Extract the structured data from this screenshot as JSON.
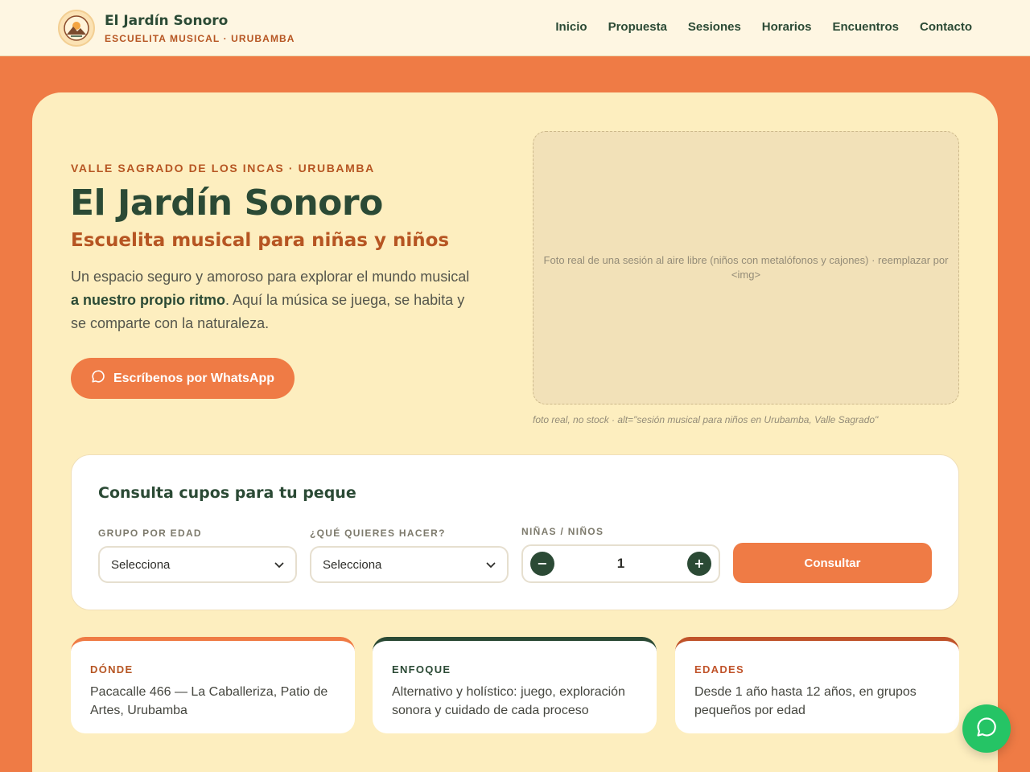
{
  "brand": {
    "name": "El Jardín Sonoro",
    "subtitle": "ESCUELITA MUSICAL · URUBAMBA",
    "logo_icon": "sun-mountain-logo-icon"
  },
  "nav": {
    "items": [
      "Inicio",
      "Propuesta",
      "Sesiones",
      "Horarios",
      "Encuentros",
      "Contacto"
    ]
  },
  "hero": {
    "eyebrow": "VALLE SAGRADO DE LOS INCAS · URUBAMBA",
    "title": "El Jardín Sonoro",
    "subtitle": "Escuelita musical para niñas y niños",
    "desc_part1": "Un espacio seguro y amoroso para explorar el mundo musical ",
    "desc_bold": "a nuestro propio ritmo",
    "desc_part2": ". Aquí la música se juega, se habita y se comparte con la naturaleza.",
    "whatsapp_label": "Escríbenos por WhatsApp",
    "whatsapp_icon": "chat-bubble-icon"
  },
  "photo": {
    "placeholder": "Foto real de una sesión al aire libre (niños con metalófonos y cajones) · reemplazar por <img>",
    "caption": "foto real, no stock · alt=\"sesión musical para niños en Urubamba, Valle Sagrado\""
  },
  "booking": {
    "title": "Consulta cupos para tu peque",
    "age_label": "GRUPO POR EDAD",
    "age_value": "Selecciona",
    "activity_label": "¿QUÉ QUIERES HACER?",
    "activity_value": "Selecciona",
    "kids_label": "NIÑAS / NIÑOS",
    "kids_minus": "−",
    "kids_value": "1",
    "kids_plus": "+",
    "submit_label": "Consultar"
  },
  "info_cards": [
    {
      "label": "DÓNDE",
      "text": "Pacacalle 466 — La Caballeriza, Patio de Artes, Urubamba"
    },
    {
      "label": "ENFOQUE",
      "text": "Alternativo y holístico: juego, exploración sonora y cuidado de cada proceso"
    },
    {
      "label": "EDADES",
      "text": "Desde 1 año hasta 12 años, en grupos pequeños por edad"
    }
  ],
  "colors": {
    "accent": "#ef7b45",
    "dark_green": "#2b4a35",
    "rust": "#b65522",
    "cream": "#fdeebf",
    "whatsapp": "#25c465"
  },
  "fab": {
    "icon": "whatsapp-chat-icon"
  }
}
